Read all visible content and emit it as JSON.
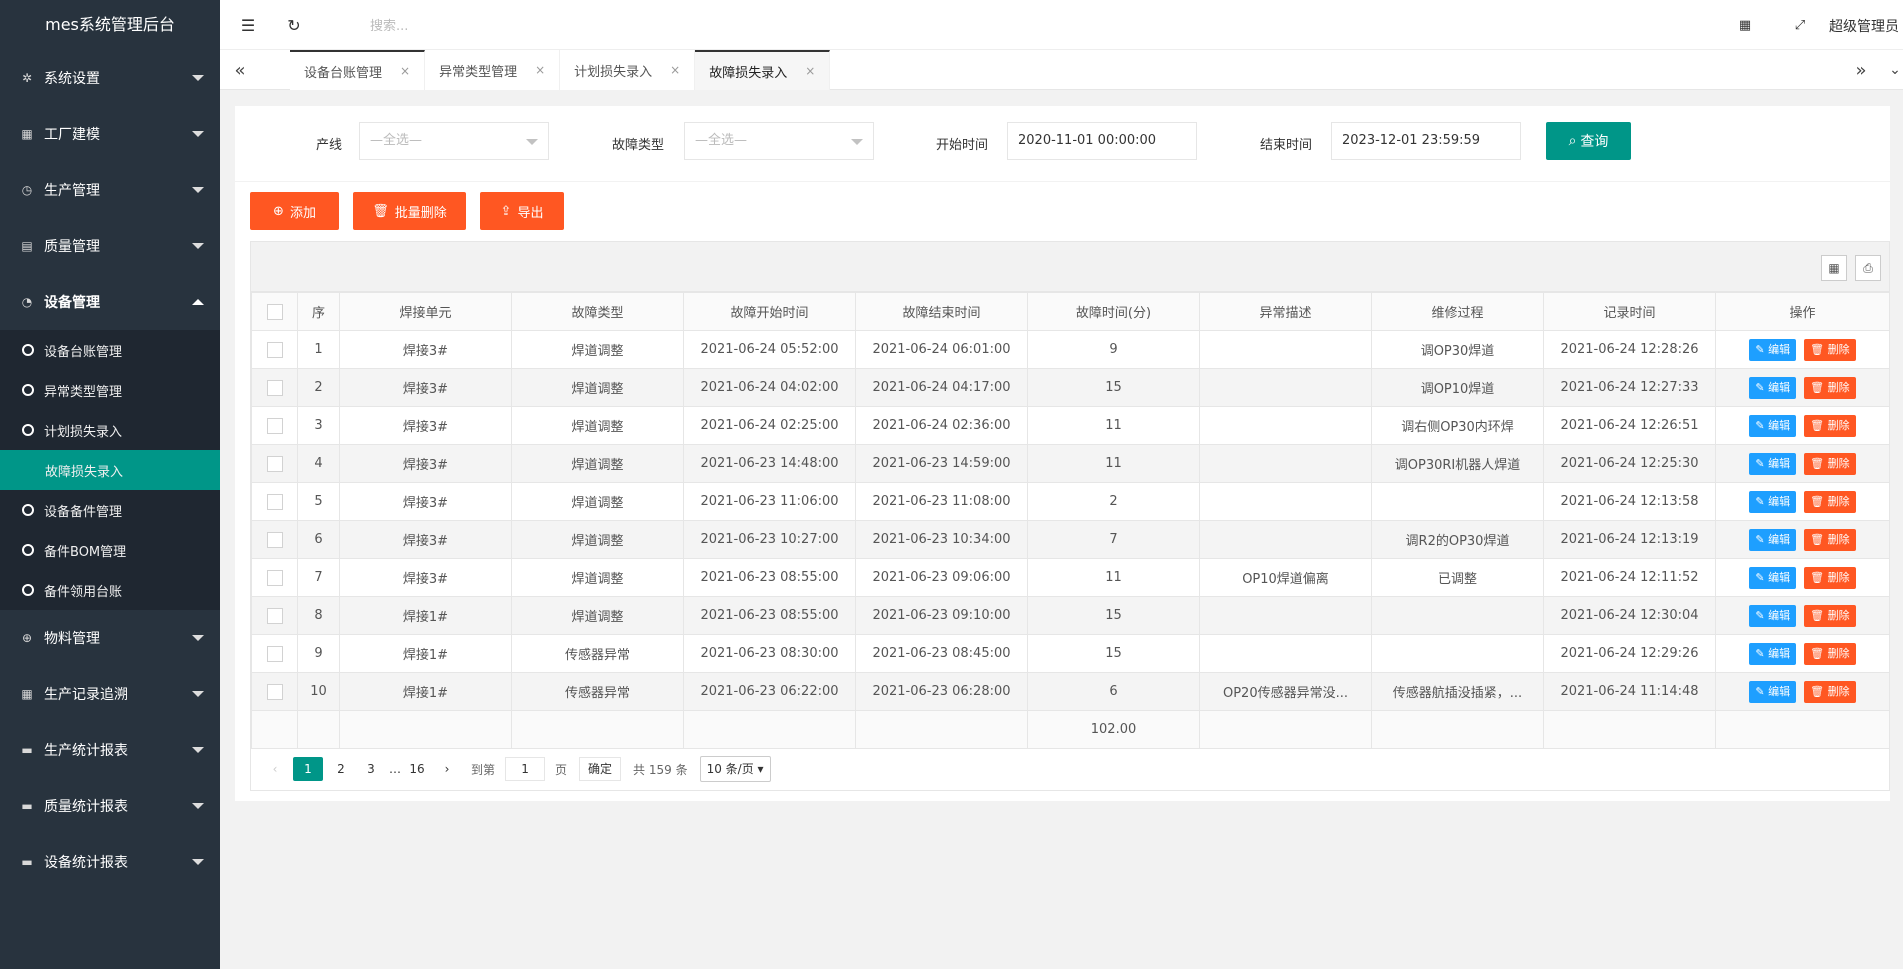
{
  "app": {
    "title": "mes系统管理后台"
  },
  "header": {
    "search_placeholder": "搜索...",
    "user": "超级管理员"
  },
  "sidebar": {
    "menus_top": [
      {
        "label": "系统设置",
        "icon": "gear-icon"
      },
      {
        "label": "工厂建模",
        "icon": "grid-icon"
      },
      {
        "label": "生产管理",
        "icon": "clock-icon"
      },
      {
        "label": "质量管理",
        "icon": "doc-icon"
      },
      {
        "label": "设备管理",
        "icon": "gauge-icon"
      }
    ],
    "submenu": [
      {
        "label": "设备台账管理"
      },
      {
        "label": "异常类型管理"
      },
      {
        "label": "计划损失录入"
      },
      {
        "label": "故障损失录入"
      },
      {
        "label": "设备备件管理"
      },
      {
        "label": "备件BOM管理"
      },
      {
        "label": "备件领用台账"
      }
    ],
    "menus_bottom": [
      {
        "label": "物料管理",
        "icon": "globe-icon"
      },
      {
        "label": "生产记录追溯",
        "icon": "table-icon"
      },
      {
        "label": "生产统计报表",
        "icon": "chat-icon"
      },
      {
        "label": "质量统计报表",
        "icon": "chat-icon"
      },
      {
        "label": "设备统计报表",
        "icon": "chat-icon"
      }
    ]
  },
  "tabs": [
    {
      "label": "设备台账管理"
    },
    {
      "label": "异常类型管理"
    },
    {
      "label": "计划损失录入"
    },
    {
      "label": "故障损失录入"
    }
  ],
  "filter": {
    "line_label": "产线",
    "line_placeholder": "—全选—",
    "fault_type_label": "故障类型",
    "fault_type_placeholder": "—全选—",
    "start_label": "开始时间",
    "start_value": "2020-11-01 00:00:00",
    "end_label": "结束时间",
    "end_value": "2023-12-01 23:59:59",
    "query_label": "查询"
  },
  "actions": {
    "add": "添加",
    "batch_delete": "批量删除",
    "export": "导出"
  },
  "table": {
    "columns": [
      "序",
      "焊接单元",
      "故障类型",
      "故障开始时间",
      "故障结束时间",
      "故障时间(分)",
      "异常描述",
      "维修过程",
      "记录时间",
      "操作"
    ],
    "edit_label": "编辑",
    "delete_label": "删除",
    "rows": [
      {
        "no": "1",
        "unit": "焊接3#",
        "type": "焊道调整",
        "start": "2021-06-24 05:52:00",
        "end": "2021-06-24 06:01:00",
        "minutes": "9",
        "desc": "",
        "repair": "调OP30焊道",
        "record": "2021-06-24 12:28:26"
      },
      {
        "no": "2",
        "unit": "焊接3#",
        "type": "焊道调整",
        "start": "2021-06-24 04:02:00",
        "end": "2021-06-24 04:17:00",
        "minutes": "15",
        "desc": "",
        "repair": "调OP10焊道",
        "record": "2021-06-24 12:27:33"
      },
      {
        "no": "3",
        "unit": "焊接3#",
        "type": "焊道调整",
        "start": "2021-06-24 02:25:00",
        "end": "2021-06-24 02:36:00",
        "minutes": "11",
        "desc": "",
        "repair": "调右侧OP30内环焊",
        "record": "2021-06-24 12:26:51"
      },
      {
        "no": "4",
        "unit": "焊接3#",
        "type": "焊道调整",
        "start": "2021-06-23 14:48:00",
        "end": "2021-06-23 14:59:00",
        "minutes": "11",
        "desc": "",
        "repair": "调OP30RI机器人焊道",
        "record": "2021-06-24 12:25:30"
      },
      {
        "no": "5",
        "unit": "焊接3#",
        "type": "焊道调整",
        "start": "2021-06-23 11:06:00",
        "end": "2021-06-23 11:08:00",
        "minutes": "2",
        "desc": "",
        "repair": "",
        "record": "2021-06-24 12:13:58"
      },
      {
        "no": "6",
        "unit": "焊接3#",
        "type": "焊道调整",
        "start": "2021-06-23 10:27:00",
        "end": "2021-06-23 10:34:00",
        "minutes": "7",
        "desc": "",
        "repair": "调R2的OP30焊道",
        "record": "2021-06-24 12:13:19"
      },
      {
        "no": "7",
        "unit": "焊接3#",
        "type": "焊道调整",
        "start": "2021-06-23 08:55:00",
        "end": "2021-06-23 09:06:00",
        "minutes": "11",
        "desc": "OP10焊道偏离",
        "repair": "已调整",
        "record": "2021-06-24 12:11:52"
      },
      {
        "no": "8",
        "unit": "焊接1#",
        "type": "焊道调整",
        "start": "2021-06-23 08:55:00",
        "end": "2021-06-23 09:10:00",
        "minutes": "15",
        "desc": "",
        "repair": "",
        "record": "2021-06-24 12:30:04"
      },
      {
        "no": "9",
        "unit": "焊接1#",
        "type": "传感器异常",
        "start": "2021-06-23 08:30:00",
        "end": "2021-06-23 08:45:00",
        "minutes": "15",
        "desc": "",
        "repair": "",
        "record": "2021-06-24 12:29:26"
      },
      {
        "no": "10",
        "unit": "焊接1#",
        "type": "传感器异常",
        "start": "2021-06-23 06:22:00",
        "end": "2021-06-23 06:28:00",
        "minutes": "6",
        "desc": "OP20传感器异常没...",
        "repair": "传感器航插没插紧，...",
        "record": "2021-06-24 11:14:48"
      }
    ],
    "total_minutes": "102.00"
  },
  "pager": {
    "pages": [
      "1",
      "2",
      "3",
      "…",
      "16"
    ],
    "goto_label": "到第",
    "goto_value": "1",
    "page_unit": "页",
    "confirm_label": "确定",
    "total_text": "共 159 条",
    "page_size": "10 条/页"
  },
  "colors": {
    "sidebar": "#28333e",
    "accent": "#009688",
    "danger": "#ff5722",
    "info": "#1e9fff"
  }
}
